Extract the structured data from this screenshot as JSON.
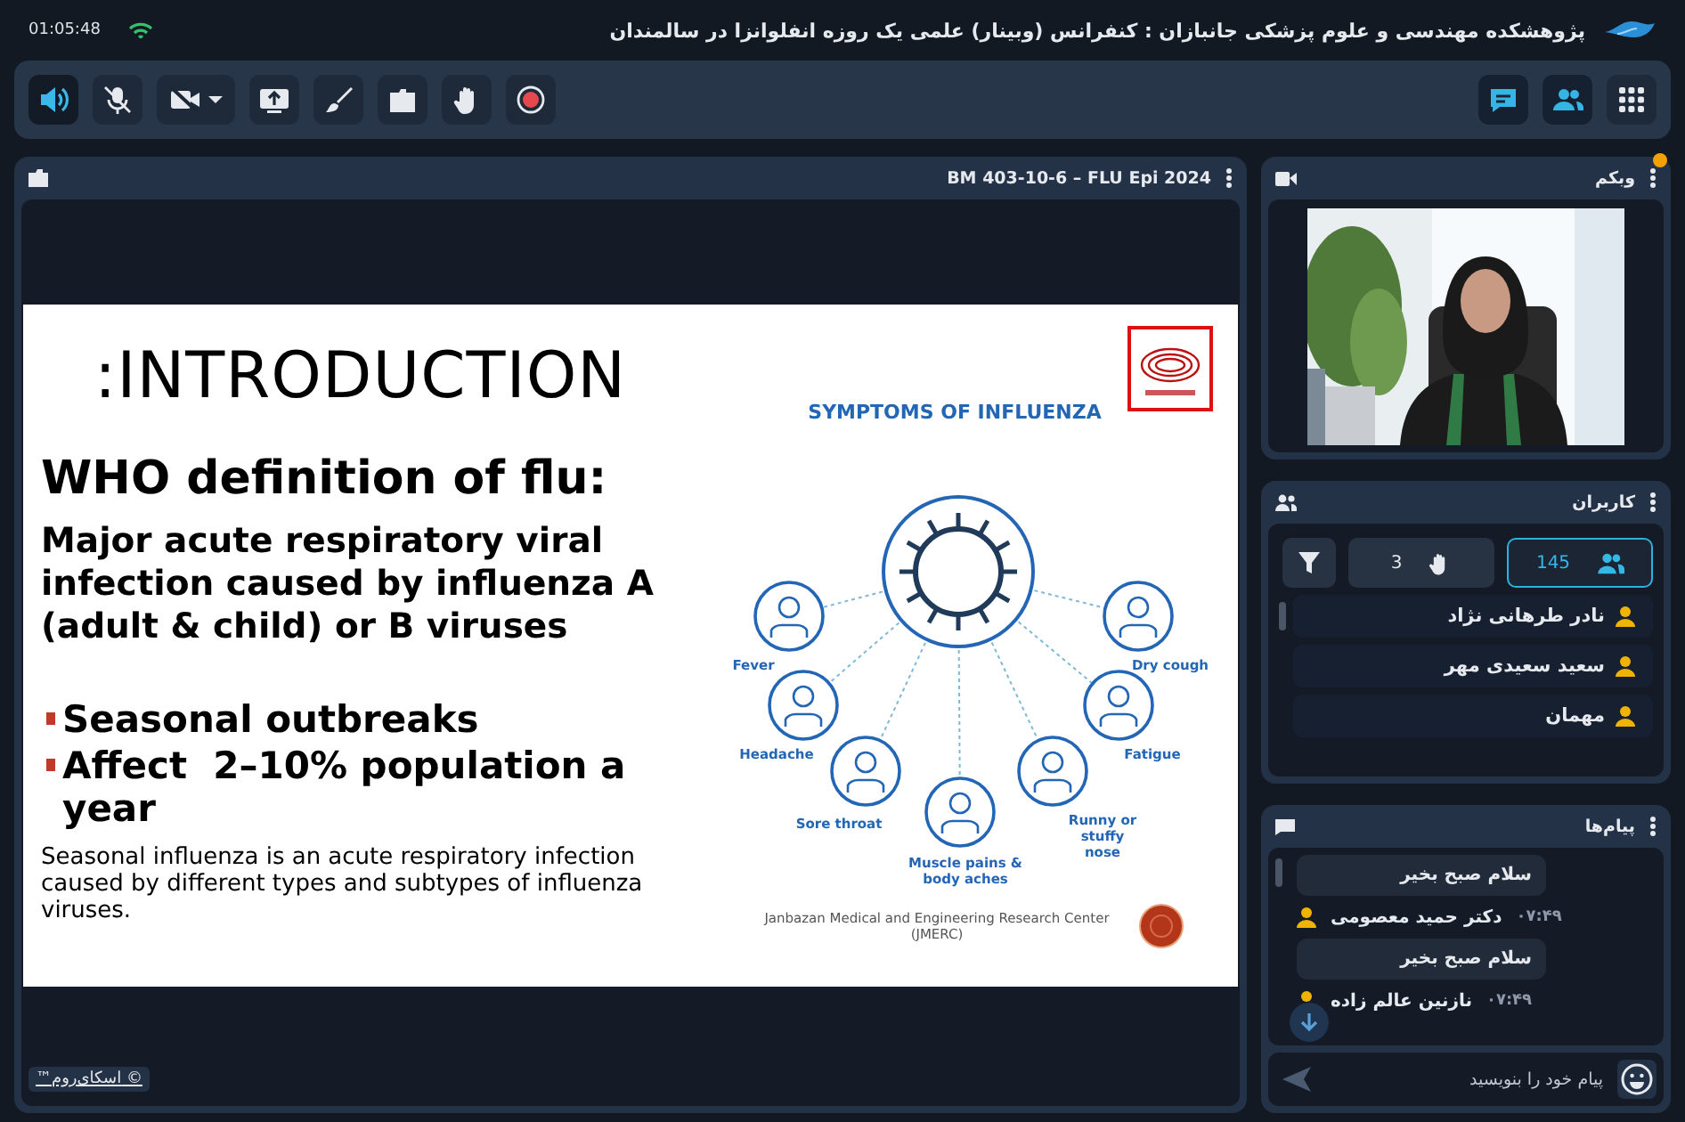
{
  "top_bar": {
    "time": "01:05:48",
    "title": "پژوهشکده مهندسی و علوم پزشکی جانبازان : کنفرانس (وبینار) علمی یک روزه انفلوانزا در سالمندان"
  },
  "toolbar": {
    "left": [
      {
        "kind": "speaker",
        "active": true
      },
      {
        "kind": "mic-off",
        "active": false
      },
      {
        "kind": "camera-off",
        "active": false
      },
      {
        "kind": "share",
        "active": false
      },
      {
        "kind": "brush",
        "active": false
      },
      {
        "kind": "folder",
        "active": false
      },
      {
        "kind": "hand",
        "active": false
      },
      {
        "kind": "record",
        "active": false
      }
    ],
    "right": [
      {
        "kind": "chat",
        "active": true
      },
      {
        "kind": "users",
        "active": true
      },
      {
        "kind": "apps",
        "active": false
      }
    ]
  },
  "stage": {
    "title": "BM 403-10-6 – FLU Epi 2024",
    "slide": {
      "heading": ":INTRODUCTION",
      "subheading": "WHO definition of flu:",
      "definition": "Major acute respiratory viral infection caused by influenza A (adult & child) or B viruses",
      "bullets": [
        "Seasonal outbreaks",
        "Affect  2–10% population a year"
      ],
      "note": "Seasonal influenza is an acute respiratory infection caused by different types and subtypes of influenza viruses.",
      "infographic": {
        "title": "SYMPTOMS OF INFLUENZA",
        "symptoms": [
          {
            "label": "Fever"
          },
          {
            "label": "Dry cough"
          },
          {
            "label": "Headache"
          },
          {
            "label": "Fatigue"
          },
          {
            "label": "Sore throat"
          },
          {
            "label": "Runny or stuffy nose"
          },
          {
            "label": "Muscle pains & body aches"
          }
        ]
      },
      "credit": "Janbazan Medical and Engineering Research Center (JMERC)"
    },
    "footer_link": "™اسکای‌روم ©"
  },
  "webcam": {
    "title": "وبکم",
    "alert": true
  },
  "users": {
    "title": "کاربران",
    "tabs": [
      {
        "kind": "all",
        "count": "145",
        "selected": true
      },
      {
        "kind": "hands",
        "count": "3",
        "selected": false
      },
      {
        "kind": "filter",
        "selected": false
      }
    ],
    "items": [
      {
        "name": "نادر طرهانی نژاد"
      },
      {
        "name": "سعید سعیدی مهر"
      },
      {
        "name": "مهمان"
      }
    ]
  },
  "messages": {
    "title": "پیام‌ها",
    "items": [
      {
        "kind": "bubble",
        "text": "سلام صبح بخیر"
      },
      {
        "kind": "author",
        "name": "دکتر حمید معصومی",
        "time": "۰۷:۴۹"
      },
      {
        "kind": "bubble",
        "text": "سلام صبح بخیر"
      },
      {
        "kind": "author",
        "name": "نازنین عالم زاده",
        "time": "۰۷:۴۹"
      }
    ],
    "placeholder": "پیام خود را بنویسید"
  }
}
